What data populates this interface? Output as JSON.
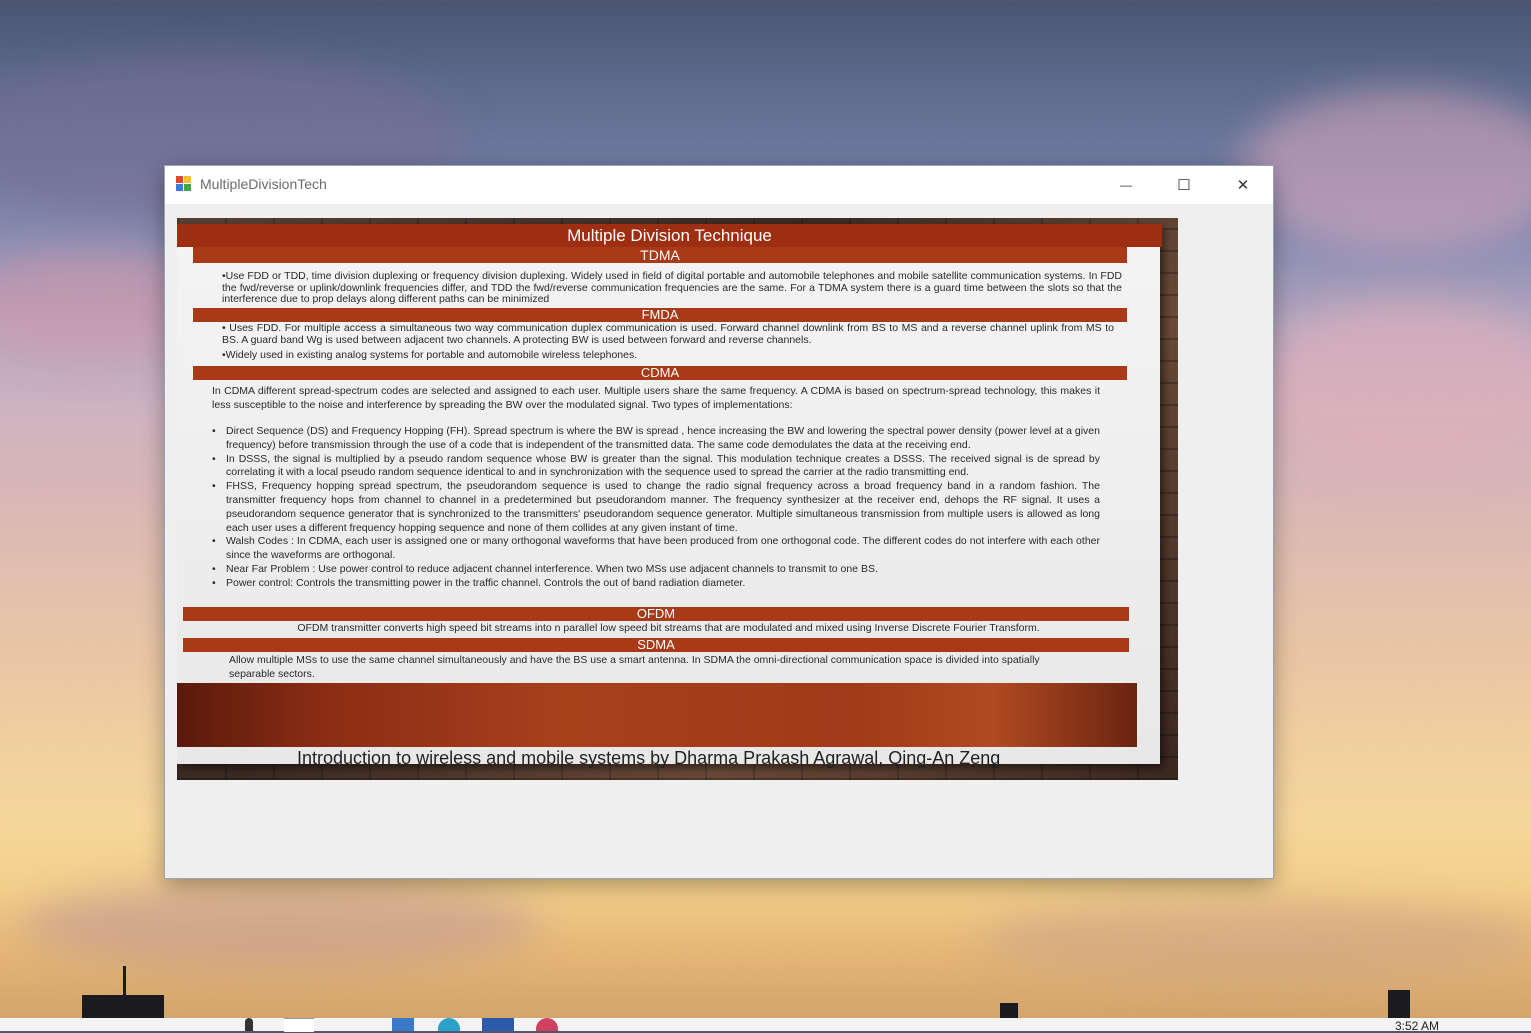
{
  "window": {
    "title": "MultipleDivisionTech",
    "controls": {
      "minimize": "—",
      "maximize": "☐",
      "close": "✕"
    }
  },
  "slide": {
    "title": "Multiple Division  Technique",
    "tdma": {
      "heading": "TDMA",
      "text": "•Use FDD or TDD, time division duplexing or frequency division duplexing. Widely used in field of digital portable and automobile telephones and mobile satellite communication systems. In FDD the fwd/reverse or uplink/downlink frequencies differ, and TDD the fwd/reverse communication frequencies are the same. For a TDMA system there is a guard time between the slots so that the interference due to prop delays along different paths can be minimized"
    },
    "fmda": {
      "heading": "FMDA",
      "text1": "• Uses FDD. For multiple access a simultaneous two way communication duplex communication is used.  Forward channel downlink from BS to MS and a reverse channel uplink from MS to BS. A guard band Wg is used between adjacent two channels. A protecting BW is used between forward and reverse channels.",
      "text2": "•Widely used in existing analog systems for portable and automobile wireless telephones."
    },
    "cdma": {
      "heading": "CDMA",
      "intro": "In CDMA different spread-spectrum codes are selected and assigned to each user. Multiple users share the same frequency.  A CDMA is based on spectrum-spread technology, this makes it less susceptible to the noise and interference by spreading the BW over the modulated signal.  Two types of implementations:",
      "items": [
        "Direct Sequence (DS) and Frequency Hopping (FH).  Spread spectrum is where the BW is spread , hence increasing the BW and lowering the spectral power density (power level at a given frequency) before transmission through the use of a code that is independent of the transmitted data. The same code demodulates the data at the receiving end.",
        "In DSSS, the signal is multiplied by a pseudo random sequence whose BW is greater than the signal. This modulation technique creates a DSSS.  The received signal is de spread by correlating it with a local pseudo random sequence identical to and in synchronization with the sequence used to spread the carrier at the radio transmitting end.",
        "FHSS, Frequency hopping spread spectrum, the pseudorandom sequence is used to change the radio signal frequency across a broad frequency band in  a random fashion.  The transmitter frequency hops from channel to channel in a predetermined but pseudorandom manner. The frequency synthesizer at the receiver end, dehops the RF signal. It uses a pseudorandom sequence generator that is synchronized to the transmitters' pseudorandom sequence generator.  Multiple simultaneous transmission from multiple users is allowed as long each user uses a different frequency hopping  sequence and none of them collides at any given instant of time.",
        "Walsh Codes : In CDMA, each user is assigned one or many orthogonal waveforms that have been produced from one orthogonal code. The different codes do not interfere with each other since the waveforms are orthogonal.",
        "Near Far Problem : Use power control to reduce adjacent channel interference. When two MSs use adjacent channels to transmit to one BS.",
        "Power control: Controls the transmitting power in the traffic channel.  Controls the out of band radiation diameter."
      ]
    },
    "ofdm": {
      "heading": "OFDM",
      "text": "OFDM transmitter converts high speed bit streams into n parallel low speed bit streams that are modulated and mixed using Inverse Discrete Fourier Transform."
    },
    "sdma": {
      "heading": "SDMA",
      "text": "Allow multiple MSs to use the same channel simultaneously and have the BS use a smart antenna. In SDMA the omni-directional communication space is divided into spatially separable sectors."
    },
    "footer": "Introduction to wireless and mobile systems by Dharma Prakash Agrawal, Qing-An Zeng"
  },
  "taskbar": {
    "time": "3:52 AM"
  }
}
